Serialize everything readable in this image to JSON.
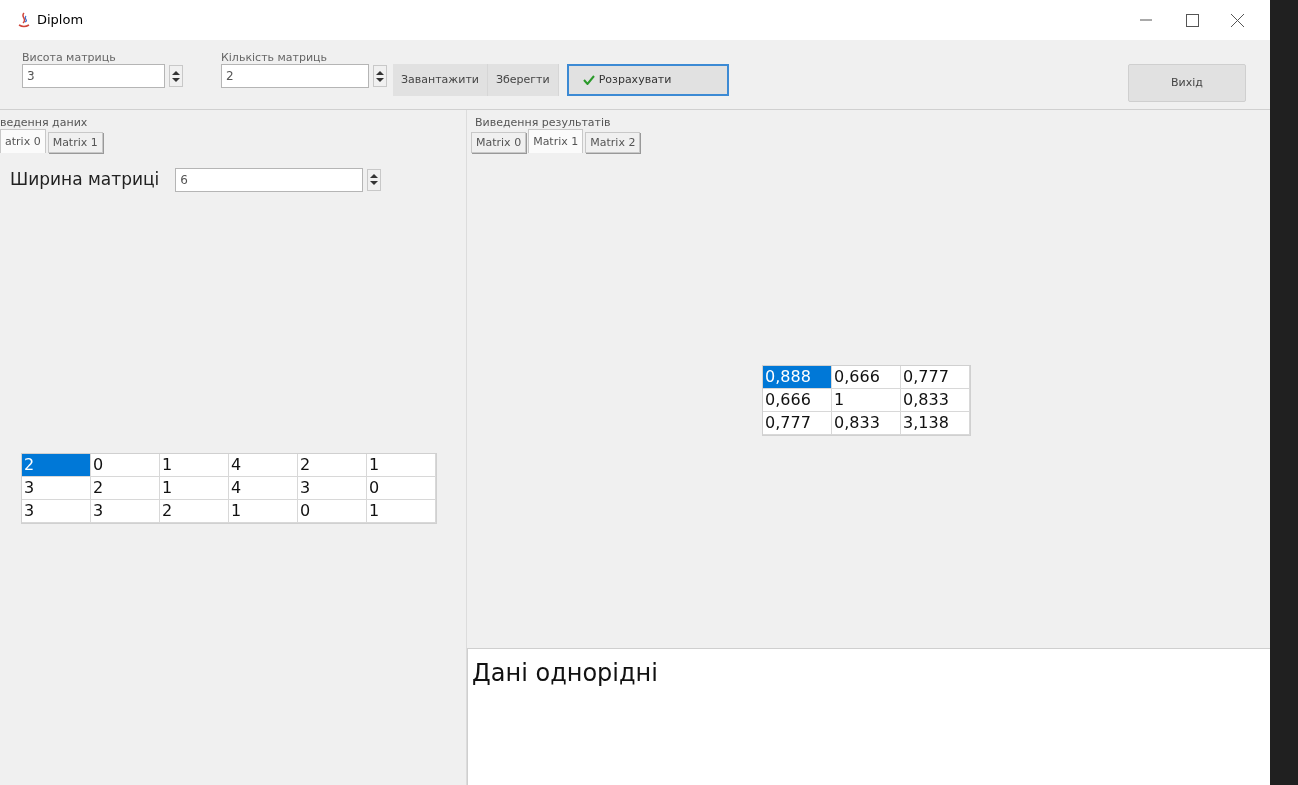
{
  "window": {
    "title": "Diplom"
  },
  "toolbar": {
    "spinners": [
      {
        "label": "Висота матриць",
        "value": "3"
      },
      {
        "label": "Кількість матриць",
        "value": "2"
      }
    ],
    "buttons": [
      {
        "label": "Завантажити",
        "kind": "flat"
      },
      {
        "label": "Зберегти",
        "kind": "flat"
      },
      {
        "label": "Розрахувати",
        "kind": "default"
      }
    ],
    "exit_button": "Вихід"
  },
  "input_panel": {
    "title": "ведення даних",
    "tabs": [
      {
        "label": "atrix 0",
        "selected": true
      },
      {
        "label": "Matrix 1",
        "selected": false
      }
    ],
    "width_label": "Ширина матриці",
    "width_value": "6",
    "rows": [
      [
        {
          "text": "2",
          "selected": true
        },
        {
          "text": "0",
          "selected": false
        },
        {
          "text": "1",
          "selected": false
        },
        {
          "text": "4",
          "selected": false
        },
        {
          "text": "2",
          "selected": false
        },
        {
          "text": "1",
          "selected": false
        }
      ],
      [
        {
          "text": "3",
          "selected": false
        },
        {
          "text": "2",
          "selected": false
        },
        {
          "text": "1",
          "selected": false
        },
        {
          "text": "4",
          "selected": false
        },
        {
          "text": "3",
          "selected": false
        },
        {
          "text": "0",
          "selected": false
        }
      ],
      [
        {
          "text": "3",
          "selected": false
        },
        {
          "text": "3",
          "selected": false
        },
        {
          "text": "2",
          "selected": false
        },
        {
          "text": "1",
          "selected": false
        },
        {
          "text": "0",
          "selected": false
        },
        {
          "text": "1",
          "selected": false
        }
      ]
    ]
  },
  "output_panel": {
    "title": "Виведення результатів",
    "tabs": [
      {
        "label": "Matrix 0",
        "selected": false
      },
      {
        "label": "Matrix 1",
        "selected": true
      },
      {
        "label": "Matrix 2",
        "selected": false
      }
    ],
    "rows": [
      [
        {
          "text": "0,888",
          "selected": true
        },
        {
          "text": "0,666",
          "selected": false
        },
        {
          "text": "0,777",
          "selected": false
        }
      ],
      [
        {
          "text": "0,666",
          "selected": false
        },
        {
          "text": "1",
          "selected": false
        },
        {
          "text": "0,833",
          "selected": false
        }
      ],
      [
        {
          "text": "0,777",
          "selected": false
        },
        {
          "text": "0,833",
          "selected": false
        },
        {
          "text": "3,138",
          "selected": false
        }
      ]
    ],
    "message": "Дані однорідні"
  }
}
